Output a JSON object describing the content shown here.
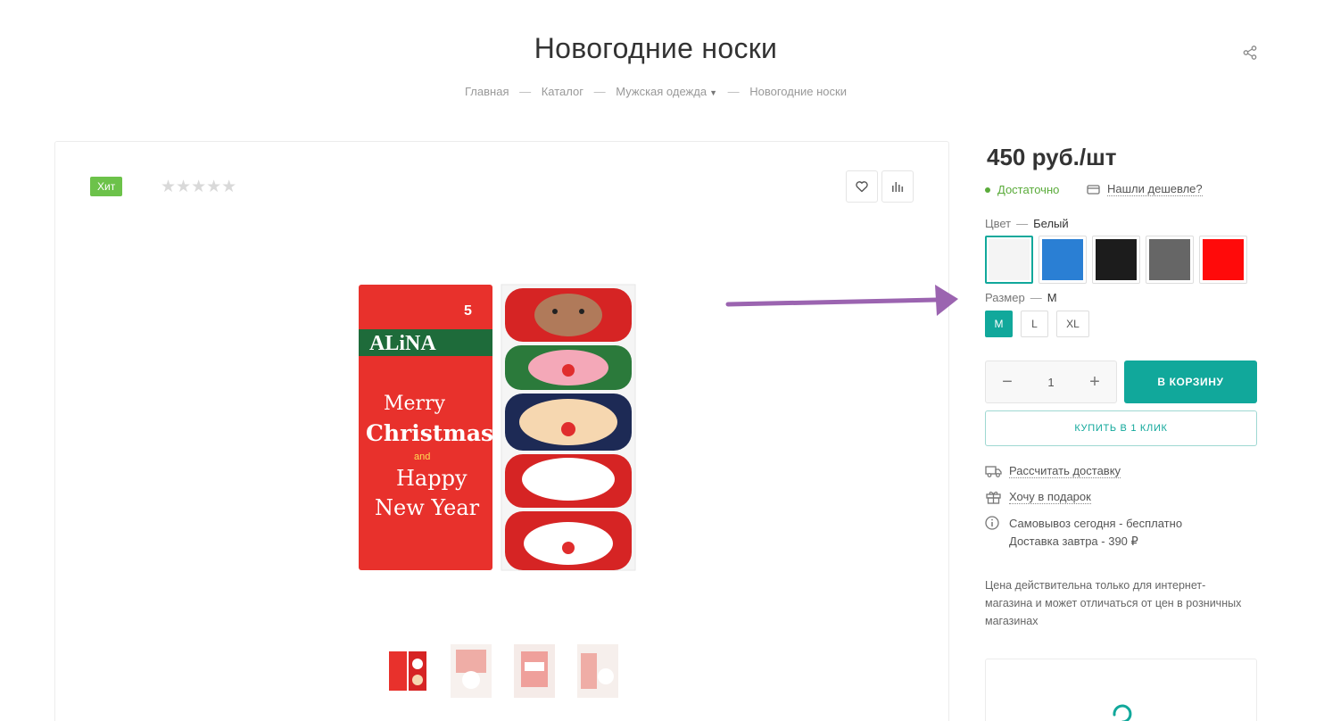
{
  "product": {
    "title": "Новогодние носки"
  },
  "breadcrumbs": [
    {
      "label": "Главная"
    },
    {
      "label": "Каталог"
    },
    {
      "label": "Мужская одежда",
      "has_dropdown": true
    },
    {
      "label": "Новогодние носки"
    }
  ],
  "breadcrumb_separator": "—",
  "gallery": {
    "badge": "Хит",
    "rating_stars": "★★★★★",
    "rating_value": 0,
    "thumbnails_count": 4,
    "box_text": {
      "brand": "ALiNA",
      "pack": "5",
      "line1": "Merry",
      "line2": "Christmas",
      "and": "and",
      "line3": "Happy",
      "line4": "New Year"
    }
  },
  "buy": {
    "price": "450 руб./шт",
    "stock": "Достаточно",
    "found_cheaper": "Нашли дешевле?",
    "color_label": "Цвет",
    "color_value": "Белый",
    "prop_dash": "—",
    "colors": [
      {
        "name": "Белый",
        "hex": "#f4f4f4",
        "selected": true
      },
      {
        "name": "Синий",
        "hex": "#2a7fd4",
        "selected": false
      },
      {
        "name": "Черный",
        "hex": "#1c1c1c",
        "selected": false
      },
      {
        "name": "Серый",
        "hex": "#666666",
        "selected": false
      },
      {
        "name": "Красный",
        "hex": "#ff0a0a",
        "selected": false
      }
    ],
    "size_label": "Размер",
    "size_value": "M",
    "sizes": [
      {
        "label": "M",
        "selected": true
      },
      {
        "label": "L",
        "selected": false
      },
      {
        "label": "XL",
        "selected": false
      }
    ],
    "quantity": "1",
    "qty_minus": "−",
    "qty_plus": "+",
    "cart_button": "В КОРЗИНУ",
    "one_click_button": "КУПИТЬ В 1 КЛИК",
    "delivery_calc": "Рассчитать доставку",
    "gift": "Хочу в подарок",
    "pickup": "Самовывоз сегодня - бесплатно",
    "delivery": "Доставка завтра - 390 ₽",
    "note": "Цена действительна только для интернет-магазина и может отличаться от цен в розничных магазинах"
  },
  "colors": {
    "accent": "#11a89b",
    "stock": "#5aab3a",
    "badge": "#6cc24a",
    "arrow": "#9b64b0"
  }
}
